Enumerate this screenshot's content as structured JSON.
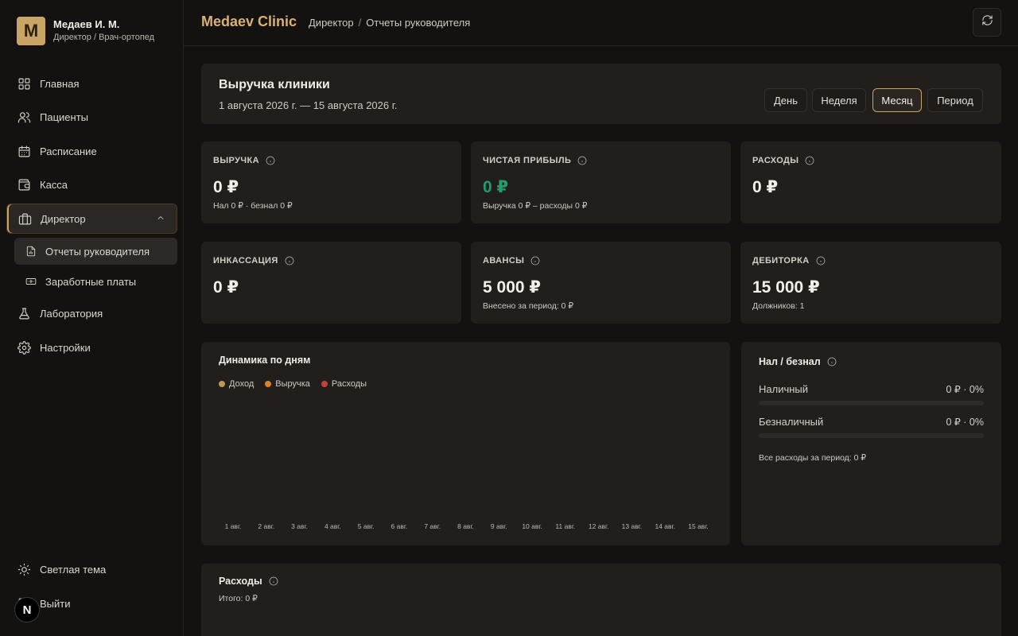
{
  "profile": {
    "initial": "M",
    "name": "Медаев И. М.",
    "role": "Директор / Врач-ортопед"
  },
  "nav": {
    "home": "Главная",
    "patients": "Пациенты",
    "schedule": "Расписание",
    "cashbox": "Касса",
    "director": "Директор",
    "reports": "Отчеты руководителя",
    "salaries": "Заработные платы",
    "lab": "Лаборатория",
    "settings": "Настройки",
    "theme": "Светлая тема",
    "logout": "Выйти"
  },
  "badge": "N",
  "header": {
    "brand": "Medaev Clinic",
    "crumb1": "Директор",
    "crumb_sep": "/",
    "crumb2": "Отчеты руководителя"
  },
  "revenue": {
    "title": "Выручка клиники",
    "dates": "1 августа 2026 г. — 15 августа 2026 г.",
    "periods": [
      "День",
      "Неделя",
      "Месяц",
      "Период"
    ],
    "active_period": "Месяц"
  },
  "kpis": [
    {
      "label": "ВЫРУЧКА",
      "value": "0 ₽",
      "sub": "Нал 0 ₽ · безнал 0 ₽"
    },
    {
      "label": "ЧИСТАЯ ПРИБЫЛЬ",
      "value": "0 ₽",
      "sub": "Выручка 0 ₽ – расходы 0 ₽"
    },
    {
      "label": "РАСХОДЫ",
      "value": "0 ₽",
      "sub": ""
    },
    {
      "label": "ИНКАССАЦИЯ",
      "value": "0 ₽",
      "sub": ""
    },
    {
      "label": "АВАНСЫ",
      "value": "5 000 ₽",
      "sub": "Внесено за период: 0 ₽"
    },
    {
      "label": "ДЕБИТОРКА",
      "value": "15 000 ₽",
      "sub": "Должников: 1"
    }
  ],
  "colors": {
    "accent": "#c8a465",
    "profit": "#1f9e6e",
    "income": "#b8995a",
    "revenue": "#d9822b",
    "expense": "#c0433f"
  },
  "dynamics": {
    "title": "Динамика по дням",
    "legend": [
      {
        "label": "Доход",
        "color": "#b8995a"
      },
      {
        "label": "Выручка",
        "color": "#d9822b"
      },
      {
        "label": "Расходы",
        "color": "#c0433f"
      }
    ]
  },
  "chart_data": {
    "type": "bar",
    "title": "Динамика по дням",
    "categories": [
      "1 авг.",
      "2 авг.",
      "3 авг.",
      "4 авг.",
      "5 авг.",
      "6 авг.",
      "7 авг.",
      "8 авг.",
      "9 авг.",
      "10 авг.",
      "11 авг.",
      "12 авг.",
      "13 авг.",
      "14 авг.",
      "15 авг."
    ],
    "series": [
      {
        "name": "Доход",
        "values": [
          0,
          0,
          0,
          0,
          0,
          0,
          0,
          0,
          0,
          0,
          0,
          0,
          0,
          0,
          0
        ]
      },
      {
        "name": "Выручка",
        "values": [
          0,
          0,
          0,
          0,
          0,
          0,
          0,
          0,
          0,
          0,
          0,
          0,
          0,
          0,
          0
        ]
      },
      {
        "name": "Расходы",
        "values": [
          0,
          0,
          0,
          0,
          0,
          0,
          0,
          0,
          0,
          0,
          0,
          0,
          0,
          0,
          0
        ]
      }
    ],
    "legend": "top-left",
    "grid": false
  },
  "payments": {
    "title": "Нал / безнал",
    "cash_label": "Наличный",
    "cash_value": "0 ₽ · 0%",
    "cash_share": 0,
    "card_label": "Безналичный",
    "card_value": "0 ₽ · 0%",
    "card_share": 0,
    "note": "Все расходы за период: 0 ₽"
  },
  "expenses": {
    "title": "Расходы",
    "total": "Итого: 0 ₽"
  }
}
